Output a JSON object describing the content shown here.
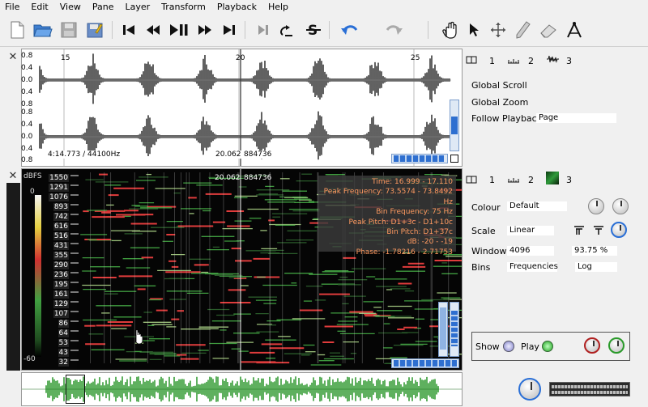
{
  "menu": [
    "File",
    "Edit",
    "View",
    "Pane",
    "Layer",
    "Transform",
    "Playback",
    "Help"
  ],
  "waveform": {
    "y_labels": [
      "0.8",
      "0.4",
      "0.0",
      "0.4",
      "0.8",
      "0.8",
      "0.4",
      "0.0",
      "0.4",
      "0.8"
    ],
    "time_ticks": [
      "15",
      "20",
      "25"
    ],
    "info_left": "4:14.773 / 44100Hz",
    "info_time": "20.062",
    "info_frame": "884736"
  },
  "spectrogram": {
    "dbfs_label": "dBFS",
    "dbfs_top": "0",
    "dbfs_bottom": "-60",
    "freq_labels": [
      "1550",
      "1291",
      "1076",
      "893",
      "742",
      "616",
      "516",
      "431",
      "355",
      "290",
      "236",
      "195",
      "161",
      "129",
      "107",
      "86",
      "64",
      "53",
      "43",
      "32"
    ],
    "info_time": "20.062",
    "info_frame": "884736",
    "tooltip": [
      "Time: 16.999 - 17.110",
      "Peak Frequency: 73.5574 - 73.8492 Hz",
      "Bin Frequency: 75 Hz",
      "Peak Pitch: D1+3c - D1+10c",
      "Bin Pitch: D1+37c",
      "dB: -20 - -19",
      "Phase: -1.78216 - 2.71753"
    ]
  },
  "panel_top": {
    "tabs": [
      "1",
      "2",
      "3"
    ],
    "global_scroll": "Global Scroll",
    "global_zoom": "Global Zoom",
    "follow_playback": "Follow Playback",
    "follow_value": "Page"
  },
  "panel_bottom": {
    "tabs": [
      "1",
      "2",
      "3"
    ],
    "colour_label": "Colour",
    "colour_value": "Default",
    "scale_label": "Scale",
    "scale_value": "Linear",
    "window_label": "Window",
    "window_value": "4096",
    "overlap_value": "93.75 %",
    "bins_label": "Bins",
    "bins_value": "Frequencies",
    "bins_scale": "Log",
    "show_label": "Show",
    "play_label": "Play"
  },
  "colors": {
    "accent": "#2a6fd6",
    "wave": "#1e1e1e",
    "overview": "#1a8f1a",
    "tooltip_text": "#ff9a60"
  }
}
